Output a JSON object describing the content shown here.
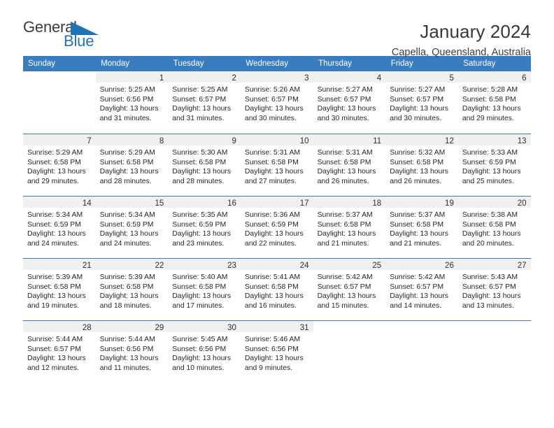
{
  "brand": {
    "word_general": "General",
    "word_blue": "Blue",
    "flag_color": "#1f72b8",
    "general_color": "#3b3b3b"
  },
  "header": {
    "month_title": "January 2024",
    "location": "Capella, Queensland, Australia",
    "accent_color": "#3a7dbf",
    "band_color": "#f0f0f0"
  },
  "weekday_headers": [
    "Sunday",
    "Monday",
    "Tuesday",
    "Wednesday",
    "Thursday",
    "Friday",
    "Saturday"
  ],
  "labels": {
    "sunrise_prefix": "Sunrise: ",
    "sunset_prefix": "Sunset: ",
    "daylight_prefix": "Daylight: "
  },
  "weeks": [
    [
      {
        "day": "",
        "sunrise": "",
        "sunset": "",
        "daylight_line1": "",
        "daylight_line2": ""
      },
      {
        "day": "1",
        "sunrise": "Sunrise: 5:25 AM",
        "sunset": "Sunset: 6:56 PM",
        "daylight_line1": "Daylight: 13 hours",
        "daylight_line2": "and 31 minutes."
      },
      {
        "day": "2",
        "sunrise": "Sunrise: 5:25 AM",
        "sunset": "Sunset: 6:57 PM",
        "daylight_line1": "Daylight: 13 hours",
        "daylight_line2": "and 31 minutes."
      },
      {
        "day": "3",
        "sunrise": "Sunrise: 5:26 AM",
        "sunset": "Sunset: 6:57 PM",
        "daylight_line1": "Daylight: 13 hours",
        "daylight_line2": "and 30 minutes."
      },
      {
        "day": "4",
        "sunrise": "Sunrise: 5:27 AM",
        "sunset": "Sunset: 6:57 PM",
        "daylight_line1": "Daylight: 13 hours",
        "daylight_line2": "and 30 minutes."
      },
      {
        "day": "5",
        "sunrise": "Sunrise: 5:27 AM",
        "sunset": "Sunset: 6:57 PM",
        "daylight_line1": "Daylight: 13 hours",
        "daylight_line2": "and 30 minutes."
      },
      {
        "day": "6",
        "sunrise": "Sunrise: 5:28 AM",
        "sunset": "Sunset: 6:58 PM",
        "daylight_line1": "Daylight: 13 hours",
        "daylight_line2": "and 29 minutes."
      }
    ],
    [
      {
        "day": "7",
        "sunrise": "Sunrise: 5:29 AM",
        "sunset": "Sunset: 6:58 PM",
        "daylight_line1": "Daylight: 13 hours",
        "daylight_line2": "and 29 minutes."
      },
      {
        "day": "8",
        "sunrise": "Sunrise: 5:29 AM",
        "sunset": "Sunset: 6:58 PM",
        "daylight_line1": "Daylight: 13 hours",
        "daylight_line2": "and 28 minutes."
      },
      {
        "day": "9",
        "sunrise": "Sunrise: 5:30 AM",
        "sunset": "Sunset: 6:58 PM",
        "daylight_line1": "Daylight: 13 hours",
        "daylight_line2": "and 28 minutes."
      },
      {
        "day": "10",
        "sunrise": "Sunrise: 5:31 AM",
        "sunset": "Sunset: 6:58 PM",
        "daylight_line1": "Daylight: 13 hours",
        "daylight_line2": "and 27 minutes."
      },
      {
        "day": "11",
        "sunrise": "Sunrise: 5:31 AM",
        "sunset": "Sunset: 6:58 PM",
        "daylight_line1": "Daylight: 13 hours",
        "daylight_line2": "and 26 minutes."
      },
      {
        "day": "12",
        "sunrise": "Sunrise: 5:32 AM",
        "sunset": "Sunset: 6:58 PM",
        "daylight_line1": "Daylight: 13 hours",
        "daylight_line2": "and 26 minutes."
      },
      {
        "day": "13",
        "sunrise": "Sunrise: 5:33 AM",
        "sunset": "Sunset: 6:59 PM",
        "daylight_line1": "Daylight: 13 hours",
        "daylight_line2": "and 25 minutes."
      }
    ],
    [
      {
        "day": "14",
        "sunrise": "Sunrise: 5:34 AM",
        "sunset": "Sunset: 6:59 PM",
        "daylight_line1": "Daylight: 13 hours",
        "daylight_line2": "and 24 minutes."
      },
      {
        "day": "15",
        "sunrise": "Sunrise: 5:34 AM",
        "sunset": "Sunset: 6:59 PM",
        "daylight_line1": "Daylight: 13 hours",
        "daylight_line2": "and 24 minutes."
      },
      {
        "day": "16",
        "sunrise": "Sunrise: 5:35 AM",
        "sunset": "Sunset: 6:59 PM",
        "daylight_line1": "Daylight: 13 hours",
        "daylight_line2": "and 23 minutes."
      },
      {
        "day": "17",
        "sunrise": "Sunrise: 5:36 AM",
        "sunset": "Sunset: 6:59 PM",
        "daylight_line1": "Daylight: 13 hours",
        "daylight_line2": "and 22 minutes."
      },
      {
        "day": "18",
        "sunrise": "Sunrise: 5:37 AM",
        "sunset": "Sunset: 6:58 PM",
        "daylight_line1": "Daylight: 13 hours",
        "daylight_line2": "and 21 minutes."
      },
      {
        "day": "19",
        "sunrise": "Sunrise: 5:37 AM",
        "sunset": "Sunset: 6:58 PM",
        "daylight_line1": "Daylight: 13 hours",
        "daylight_line2": "and 21 minutes."
      },
      {
        "day": "20",
        "sunrise": "Sunrise: 5:38 AM",
        "sunset": "Sunset: 6:58 PM",
        "daylight_line1": "Daylight: 13 hours",
        "daylight_line2": "and 20 minutes."
      }
    ],
    [
      {
        "day": "21",
        "sunrise": "Sunrise: 5:39 AM",
        "sunset": "Sunset: 6:58 PM",
        "daylight_line1": "Daylight: 13 hours",
        "daylight_line2": "and 19 minutes."
      },
      {
        "day": "22",
        "sunrise": "Sunrise: 5:39 AM",
        "sunset": "Sunset: 6:58 PM",
        "daylight_line1": "Daylight: 13 hours",
        "daylight_line2": "and 18 minutes."
      },
      {
        "day": "23",
        "sunrise": "Sunrise: 5:40 AM",
        "sunset": "Sunset: 6:58 PM",
        "daylight_line1": "Daylight: 13 hours",
        "daylight_line2": "and 17 minutes."
      },
      {
        "day": "24",
        "sunrise": "Sunrise: 5:41 AM",
        "sunset": "Sunset: 6:58 PM",
        "daylight_line1": "Daylight: 13 hours",
        "daylight_line2": "and 16 minutes."
      },
      {
        "day": "25",
        "sunrise": "Sunrise: 5:42 AM",
        "sunset": "Sunset: 6:57 PM",
        "daylight_line1": "Daylight: 13 hours",
        "daylight_line2": "and 15 minutes."
      },
      {
        "day": "26",
        "sunrise": "Sunrise: 5:42 AM",
        "sunset": "Sunset: 6:57 PM",
        "daylight_line1": "Daylight: 13 hours",
        "daylight_line2": "and 14 minutes."
      },
      {
        "day": "27",
        "sunrise": "Sunrise: 5:43 AM",
        "sunset": "Sunset: 6:57 PM",
        "daylight_line1": "Daylight: 13 hours",
        "daylight_line2": "and 13 minutes."
      }
    ],
    [
      {
        "day": "28",
        "sunrise": "Sunrise: 5:44 AM",
        "sunset": "Sunset: 6:57 PM",
        "daylight_line1": "Daylight: 13 hours",
        "daylight_line2": "and 12 minutes."
      },
      {
        "day": "29",
        "sunrise": "Sunrise: 5:44 AM",
        "sunset": "Sunset: 6:56 PM",
        "daylight_line1": "Daylight: 13 hours",
        "daylight_line2": "and 11 minutes."
      },
      {
        "day": "30",
        "sunrise": "Sunrise: 5:45 AM",
        "sunset": "Sunset: 6:56 PM",
        "daylight_line1": "Daylight: 13 hours",
        "daylight_line2": "and 10 minutes."
      },
      {
        "day": "31",
        "sunrise": "Sunrise: 5:46 AM",
        "sunset": "Sunset: 6:56 PM",
        "daylight_line1": "Daylight: 13 hours",
        "daylight_line2": "and 9 minutes."
      },
      {
        "day": "",
        "sunrise": "",
        "sunset": "",
        "daylight_line1": "",
        "daylight_line2": ""
      },
      {
        "day": "",
        "sunrise": "",
        "sunset": "",
        "daylight_line1": "",
        "daylight_line2": ""
      },
      {
        "day": "",
        "sunrise": "",
        "sunset": "",
        "daylight_line1": "",
        "daylight_line2": ""
      }
    ]
  ]
}
